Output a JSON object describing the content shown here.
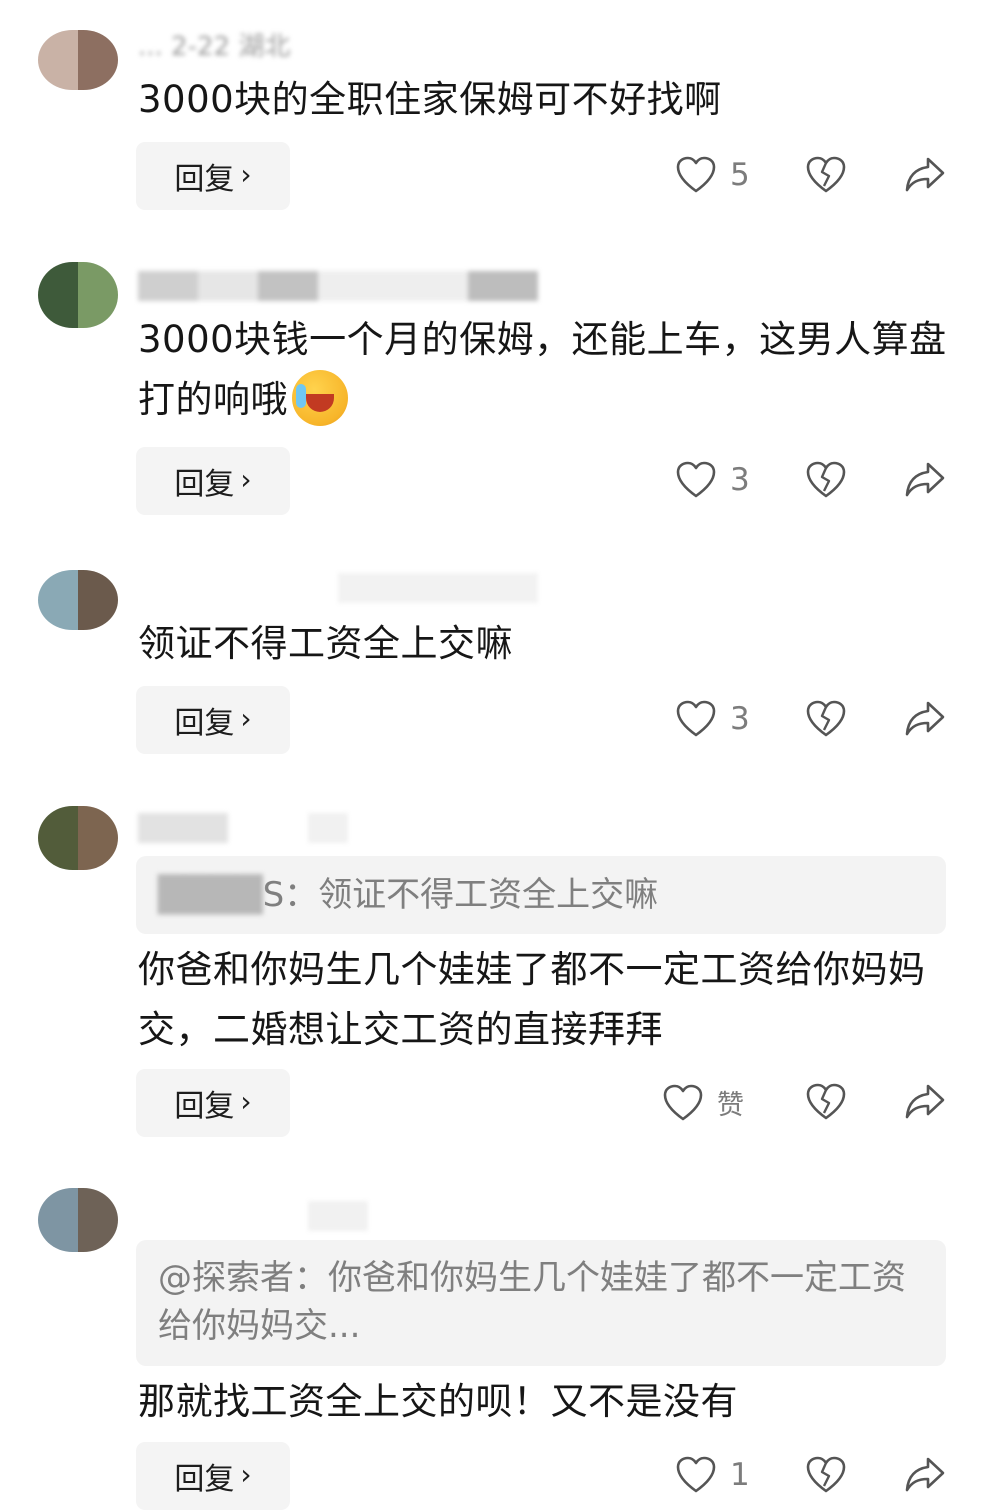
{
  "comments": [
    {
      "meta": "... 2-22 湖北",
      "text": "3000块的全职住家保姆可不好找啊",
      "reply_label": "回复",
      "like_count": "5",
      "avatar_colors": [
        "#c9b2a6",
        "#8d6f61"
      ]
    },
    {
      "meta": "",
      "text": "3000块钱一个月的保姆，还能上车，这男人算盘打的响哦",
      "reply_label": "回复",
      "like_count": "3",
      "avatar_colors": [
        "#3e5a3a",
        "#7a9a65"
      ]
    },
    {
      "meta": "",
      "text": "领证不得工资全上交嘛",
      "reply_label": "回复",
      "like_count": "3",
      "avatar_colors": [
        "#8aa9b5",
        "#6b5a4c"
      ]
    },
    {
      "meta": "",
      "quote_prefix": "S：",
      "quote": "领证不得工资全上交嘛",
      "text": "你爸和你妈生几个娃娃了都不一定工资给你妈妈交，二婚想让交工资的直接拜拜",
      "reply_label": "回复",
      "like_label": "赞",
      "avatar_colors": [
        "#525c3a",
        "#7d6550"
      ]
    },
    {
      "meta": "",
      "quote": "@探索者：你爸和你妈生几个娃娃了都不一定工资给你妈妈交...",
      "text": "那就找工资全上交的呗！又不是没有",
      "reply_label": "回复",
      "like_count": "1",
      "avatar_colors": [
        "#7e95a3",
        "#6e6257"
      ]
    }
  ],
  "colors": {
    "text": "#161616",
    "muted": "#7c7c7c",
    "button_bg": "#f4f4f4",
    "quote_bg": "#f3f3f3"
  },
  "icons": [
    "heart-outline-icon",
    "broken-heart-icon",
    "share-arrow-icon",
    "chevron-right-icon"
  ]
}
